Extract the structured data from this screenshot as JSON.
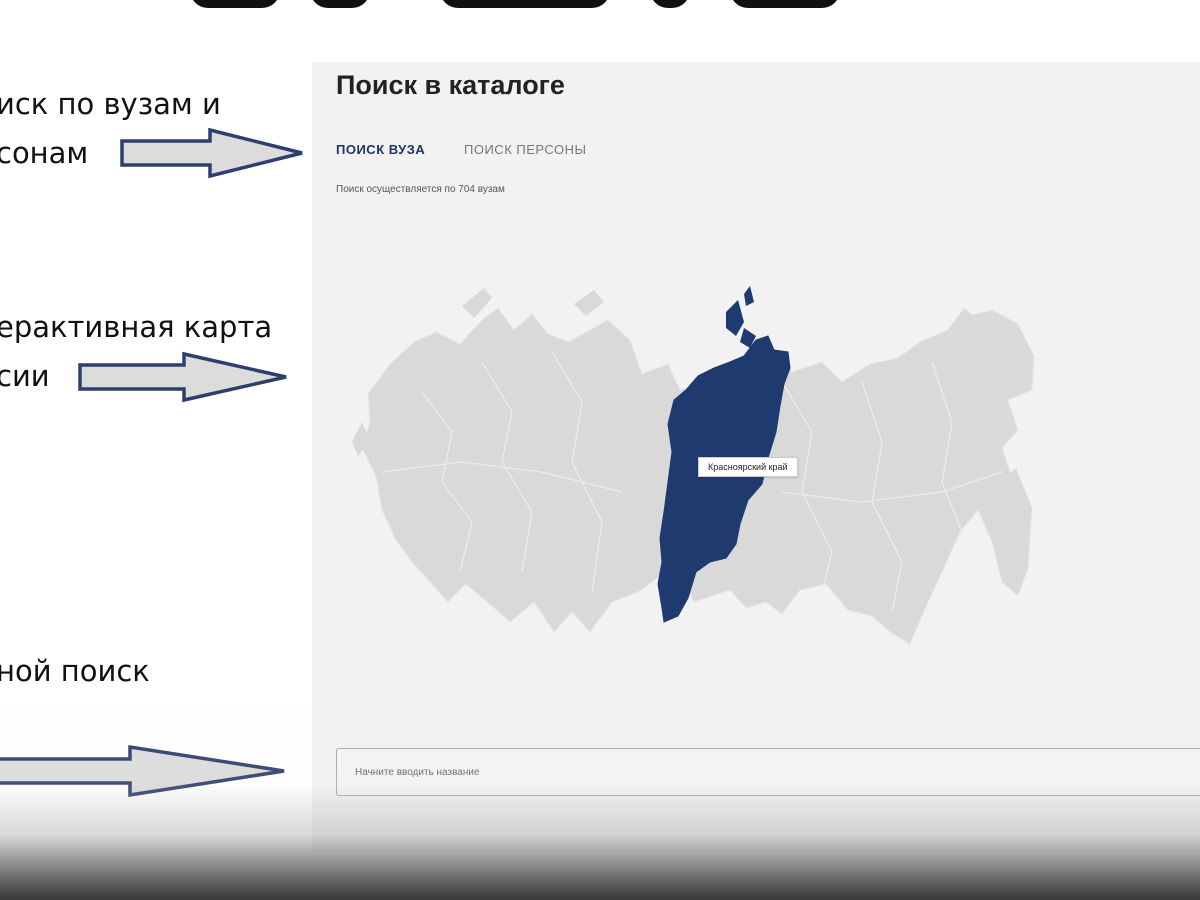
{
  "annotations": {
    "tabs_note": {
      "line1": "иск по вузам и",
      "line2": "сонам"
    },
    "map_note": {
      "line1": "ерактивная карта",
      "line2": "сии"
    },
    "search_note": {
      "line1": "ной поиск"
    }
  },
  "catalog": {
    "title": "Поиск в каталоге",
    "tabs": [
      {
        "label": "ПОИСК ВУЗА",
        "active": true
      },
      {
        "label": "ПОИСК ПЕРСОНЫ",
        "active": false
      }
    ],
    "search_count_text": "Поиск осуществляется по 704 вузам",
    "map": {
      "selected_region": "Красноярский край",
      "region_color": "#1f3a6e",
      "base_color": "#d9d9d9"
    },
    "search": {
      "placeholder": "Начните вводить название",
      "value": ""
    }
  },
  "colors": {
    "accent": "#1e3466",
    "arrow_fill": "#dcdcdc",
    "arrow_stroke": "#2e3e6e"
  }
}
